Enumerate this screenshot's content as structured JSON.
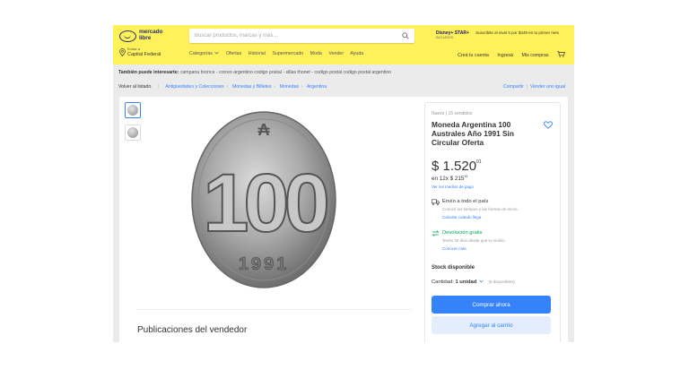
{
  "header": {
    "logo_line1": "mercado",
    "logo_line2": "libre",
    "search_placeholder": "Buscar productos, marcas y más…",
    "promo_brand": "Disney+ STAR+",
    "promo_sub": "INCLUIDOS",
    "promo_text": "Suscribite al nivel 6 por $449 en tu primer mes",
    "location_top": "Enviar a",
    "location_bottom": "Capital Federal",
    "nav": [
      "Categorías",
      "Ofertas",
      "Historial",
      "Supermercado",
      "Moda",
      "Vender",
      "Ayuda"
    ],
    "account": [
      "Creá tu cuenta",
      "Ingresá",
      "Mis compras"
    ]
  },
  "interest": {
    "label": "También puede interesarte:",
    "links": "campana bronce - correo argentino codigo postal - sillas thonet - codigo postal codigo postal argentino"
  },
  "breadcrumb": {
    "back": "Volver al listado",
    "items": [
      "Antigüedades y Colecciones",
      "Monedas y Billetes",
      "Monedas",
      "Argentina"
    ],
    "share": "Compartir",
    "sell_same": "Vender uno igual"
  },
  "product": {
    "condition": "Nuevo  |  15 vendidos",
    "title": "Moneda Argentina 100 Australes Año 1991 Sin Circular Oferta",
    "price": "$ 1.520",
    "price_cents": "01",
    "installments": "en 12x $ 215",
    "installments_cents": "15",
    "payment_link": "Ver los medios de pago",
    "shipping_title": "Envío a todo el país",
    "shipping_sub": "Conocé los tiempos y las formas de envío.",
    "shipping_link": "Calcular cuándo llega",
    "return_title": "Devolución gratis",
    "return_sub": "Tenés 30 días desde que lo recibís.",
    "return_link": "Conocer más",
    "stock": "Stock disponible",
    "qty_label": "Cantidad:",
    "qty_value": "1 unidad",
    "qty_available": "(5 disponibles)",
    "buy_button": "Comprar ahora",
    "cart_button": "Agregar al carrito",
    "coin_value": "100",
    "coin_year": "1991"
  },
  "seller_section": "Publicaciones del vendedor",
  "colors": {
    "header": "#fff159",
    "accent": "#3483fa",
    "green": "#00a650",
    "logo": "#2d3277"
  }
}
